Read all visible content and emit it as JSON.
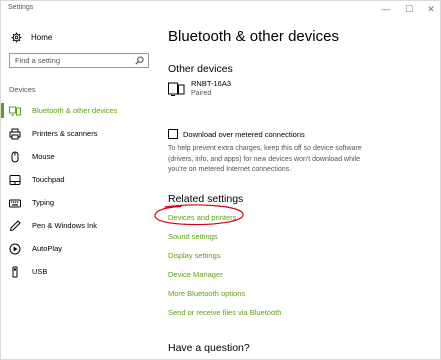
{
  "window": {
    "title": "Settings",
    "controls": {
      "minimize": "—",
      "maximize": "☐",
      "close": "✕"
    }
  },
  "sidebar": {
    "home_label": "Home",
    "search_placeholder": "Find a setting",
    "section_label": "Devices",
    "items": [
      {
        "label": "Bluetooth & other devices",
        "icon": "bluetooth-devices-icon",
        "active": true
      },
      {
        "label": "Printers & scanners",
        "icon": "printer-icon",
        "active": false
      },
      {
        "label": "Mouse",
        "icon": "mouse-icon",
        "active": false
      },
      {
        "label": "Touchpad",
        "icon": "touchpad-icon",
        "active": false
      },
      {
        "label": "Typing",
        "icon": "keyboard-icon",
        "active": false
      },
      {
        "label": "Pen & Windows Ink",
        "icon": "pen-icon",
        "active": false
      },
      {
        "label": "AutoPlay",
        "icon": "autoplay-icon",
        "active": false
      },
      {
        "label": "USB",
        "icon": "usb-icon",
        "active": false
      }
    ]
  },
  "main": {
    "title": "Bluetooth & other devices",
    "other_devices_heading": "Other devices",
    "device": {
      "name": "RNBT-16A3",
      "status": "Paired"
    },
    "metered_label": "Download over metered connections",
    "metered_checked": false,
    "metered_description": "To help prevent extra charges, keep this off so device software (drivers, info, and apps) for new devices won't download while you're on metered Internet connections.",
    "related_heading": "Related settings",
    "related_links": [
      "Devices and printers",
      "Sound settings",
      "Display settings",
      "Device Manager",
      "More Bluetooth options",
      "Send or receive files via Bluetooth"
    ],
    "question_heading": "Have a question?"
  },
  "colors": {
    "accent": "#5fa114",
    "annotation": "#d0021b",
    "secondary_text": "#555555"
  }
}
